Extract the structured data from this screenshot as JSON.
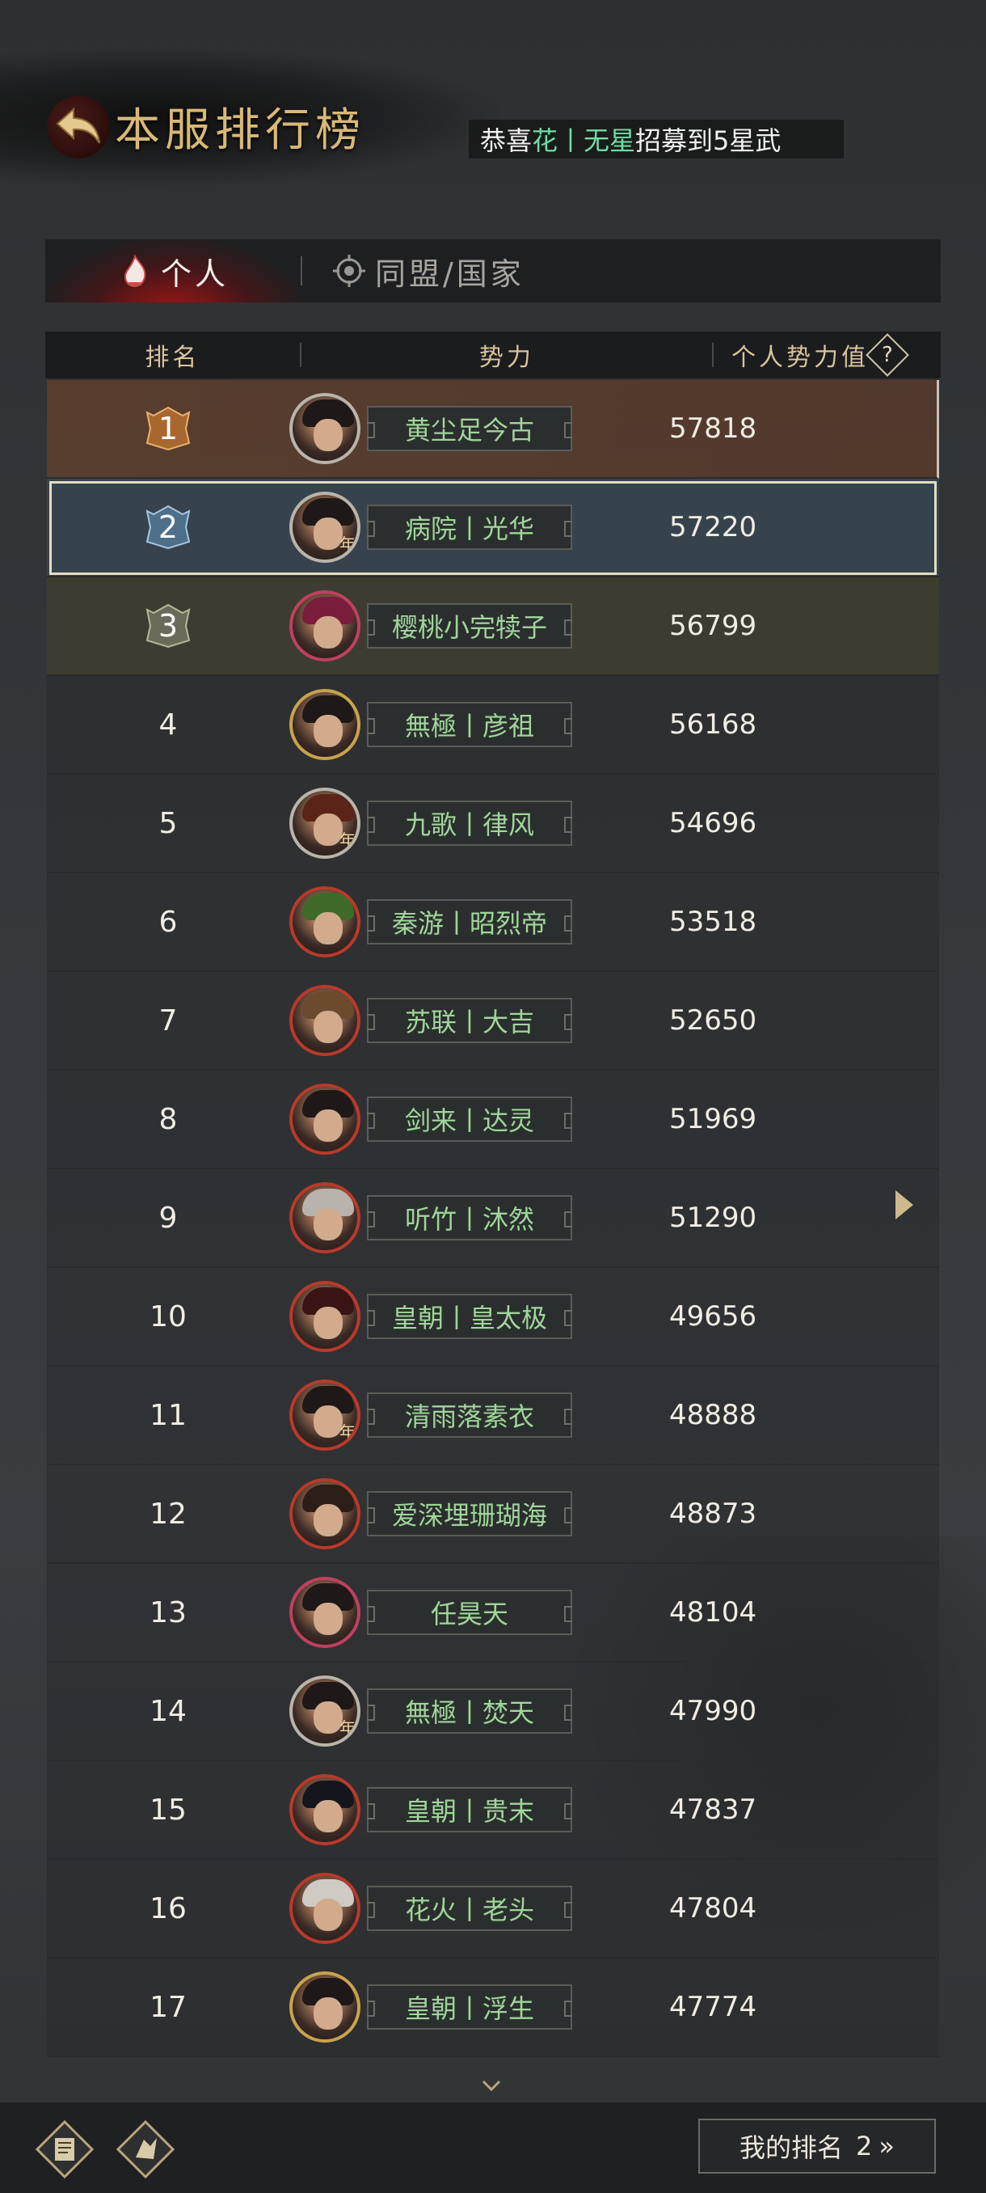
{
  "header": {
    "title": "本服排行榜",
    "notice": {
      "prefix": "恭喜",
      "player": "花丨无星",
      "suffix": "招募到5星武"
    }
  },
  "tabs": [
    {
      "label": "个人",
      "icon": "flame-icon",
      "active": true
    },
    {
      "label": "同盟/国家",
      "icon": "alliance-emblem-icon",
      "active": false
    }
  ],
  "table": {
    "columns": {
      "rank": "排名",
      "power": "势力",
      "value": "个人势力值",
      "help": "?"
    },
    "rows": [
      {
        "rank": "1",
        "name": "黄尘足今古",
        "value": "57818"
      },
      {
        "rank": "2",
        "name": "病院丨光华",
        "value": "57220"
      },
      {
        "rank": "3",
        "name": "樱桃小完犊子",
        "value": "56799"
      },
      {
        "rank": "4",
        "name": "無極丨彦祖",
        "value": "56168"
      },
      {
        "rank": "5",
        "name": "九歌丨律风",
        "value": "54696"
      },
      {
        "rank": "6",
        "name": "秦游丨昭烈帝",
        "value": "53518"
      },
      {
        "rank": "7",
        "name": "苏联丨大吉",
        "value": "52650"
      },
      {
        "rank": "8",
        "name": "剑来丨达灵",
        "value": "51969"
      },
      {
        "rank": "9",
        "name": "听竹丨沐然",
        "value": "51290"
      },
      {
        "rank": "10",
        "name": "皇朝丨皇太极",
        "value": "49656"
      },
      {
        "rank": "11",
        "name": "清雨落素衣",
        "value": "48888"
      },
      {
        "rank": "12",
        "name": "爱深埋珊瑚海",
        "value": "48873"
      },
      {
        "rank": "13",
        "name": "任昊天",
        "value": "48104"
      },
      {
        "rank": "14",
        "name": "無極丨焚天",
        "value": "47990"
      },
      {
        "rank": "15",
        "name": "皇朝丨贵末",
        "value": "47837"
      },
      {
        "rank": "16",
        "name": "花火丨老头",
        "value": "47804"
      },
      {
        "rank": "17",
        "name": "皇朝丨浮生",
        "value": "47774"
      }
    ]
  },
  "avatar_tag": "年",
  "footer": {
    "my_rank_label": "我的排名",
    "my_rank_value": "2",
    "chevrons": "»"
  },
  "colors": {
    "title_gold": "#d9b877",
    "name_green": "#9fd69a",
    "notice_highlight": "#6fdca6",
    "active_tab_red": "#be1414"
  }
}
